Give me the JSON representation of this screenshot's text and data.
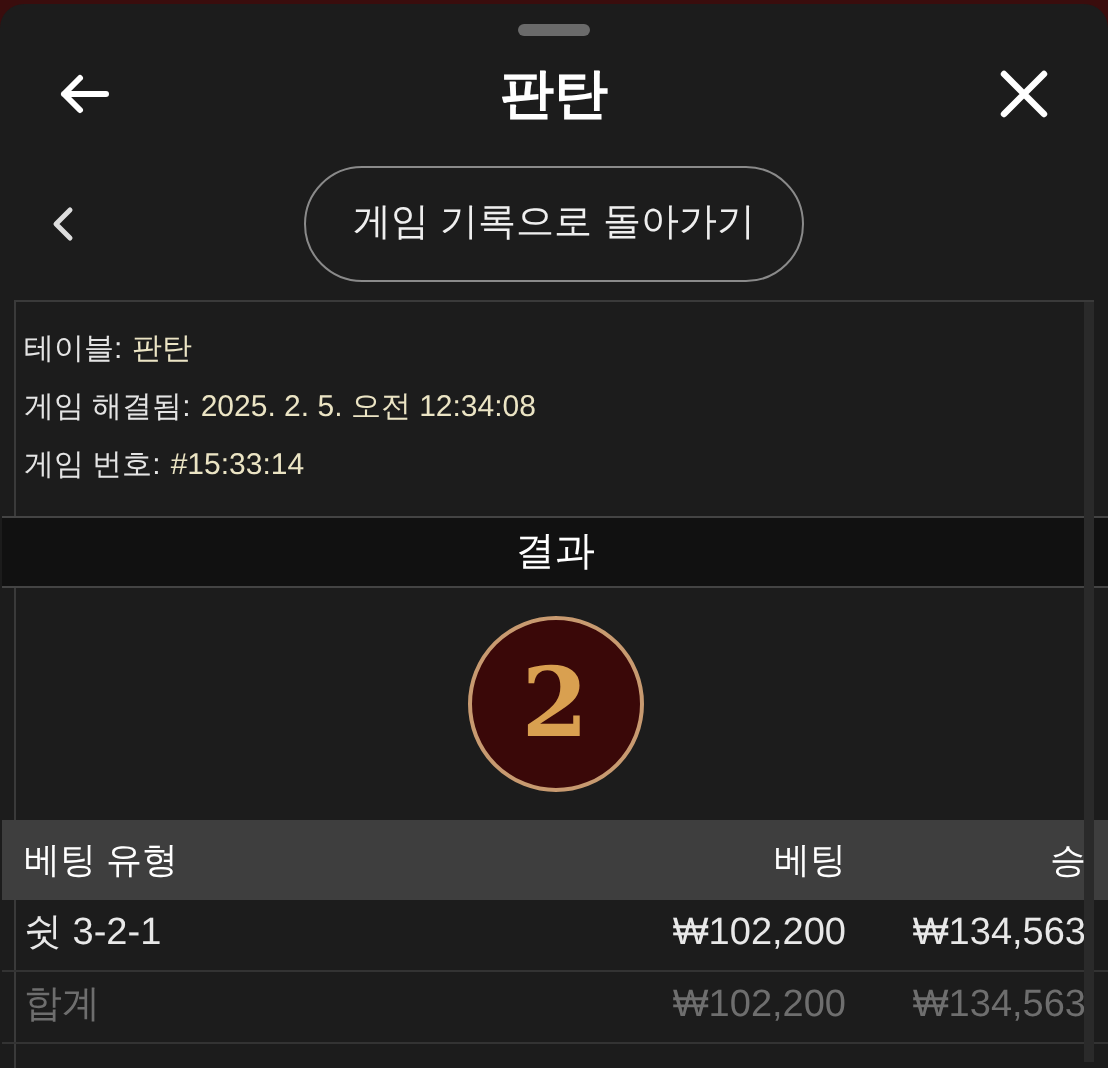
{
  "header": {
    "title": "판탄"
  },
  "back_button": {
    "label": "게임 기록으로 돌아가기"
  },
  "info": [
    {
      "label": "테이블:",
      "value": "판탄"
    },
    {
      "label": "게임 해결됨:",
      "value": "2025. 2. 5. 오전 12:34:08"
    },
    {
      "label": "게임 번호:",
      "value": "#15:33:14"
    }
  ],
  "result": {
    "title": "결과",
    "number": "2"
  },
  "table": {
    "columns": [
      "베팅 유형",
      "베팅",
      "승"
    ],
    "rows": [
      {
        "kind": "bet",
        "cells": [
          "쉿 3-2-1",
          "₩102,200",
          "₩134,563"
        ]
      },
      {
        "kind": "total",
        "cells": [
          "합계",
          "₩102,200",
          "₩134,563"
        ]
      }
    ]
  }
}
